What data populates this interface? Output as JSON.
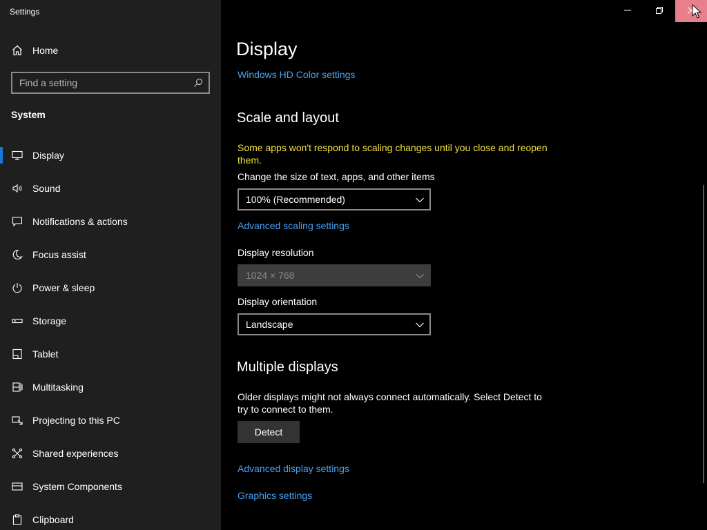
{
  "window": {
    "title": "Settings",
    "controls": {
      "minimize": "minimize-icon",
      "maximize": "restore-icon",
      "close": "close-icon",
      "close_hover_color": "#e87f8c"
    }
  },
  "sidebar": {
    "home_label": "Home",
    "search_placeholder": "Find a setting",
    "section_title": "System",
    "accent_color": "#1a78d6",
    "items": [
      {
        "label": "Display",
        "icon": "monitor-icon",
        "active": true
      },
      {
        "label": "Sound",
        "icon": "speaker-icon"
      },
      {
        "label": "Notifications & actions",
        "icon": "notification-icon"
      },
      {
        "label": "Focus assist",
        "icon": "moon-icon"
      },
      {
        "label": "Power & sleep",
        "icon": "power-icon"
      },
      {
        "label": "Storage",
        "icon": "storage-icon"
      },
      {
        "label": "Tablet",
        "icon": "tablet-icon"
      },
      {
        "label": "Multitasking",
        "icon": "multitasking-icon"
      },
      {
        "label": "Projecting to this PC",
        "icon": "projecting-icon"
      },
      {
        "label": "Shared experiences",
        "icon": "shared-icon"
      },
      {
        "label": "System Components",
        "icon": "components-icon"
      },
      {
        "label": "Clipboard",
        "icon": "clipboard-icon"
      }
    ]
  },
  "main": {
    "title": "Display",
    "hd_color_link": "Windows HD Color settings",
    "scale_heading": "Scale and layout",
    "scale_warning": "Some apps won't respond to scaling changes until you close and reopen them.",
    "size_label": "Change the size of text, apps, and other items",
    "size_value": "100% (Recommended)",
    "advanced_scaling_link": "Advanced scaling settings",
    "resolution_label": "Display resolution",
    "resolution_value": "1024 × 768",
    "orientation_label": "Display orientation",
    "orientation_value": "Landscape",
    "multiple_heading": "Multiple displays",
    "multiple_desc": "Older displays might not always connect automatically. Select Detect to try to connect to them.",
    "detect_button": "Detect",
    "advanced_display_link": "Advanced display settings",
    "graphics_link": "Graphics settings",
    "link_color": "#4aa0f0",
    "warning_color": "#f0e040"
  }
}
